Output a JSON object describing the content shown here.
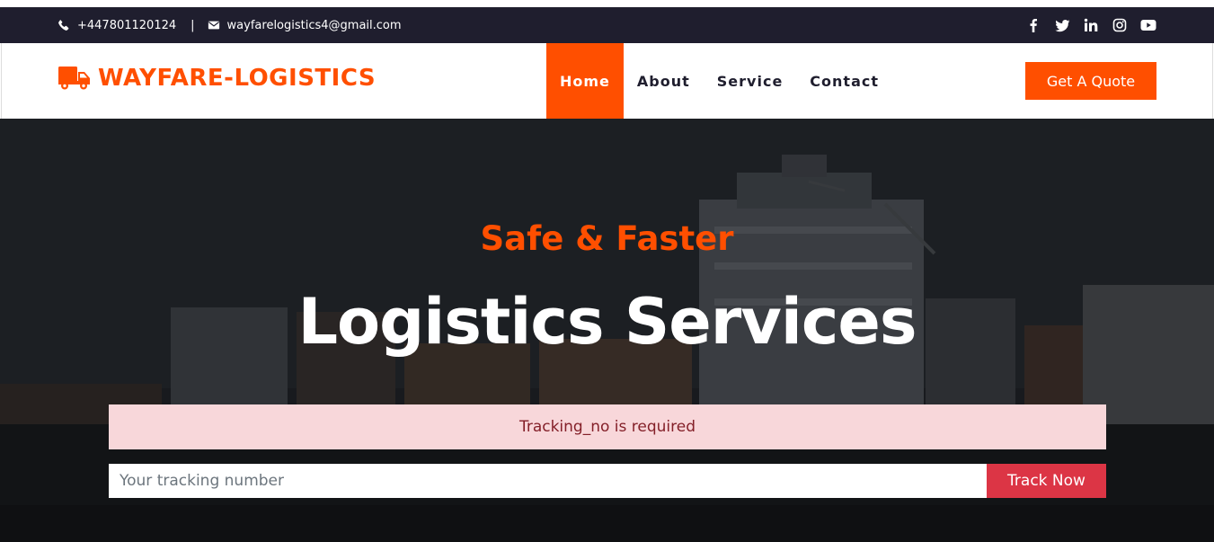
{
  "topbar": {
    "phone": "+447801120124",
    "separator": "|",
    "email": "wayfarelogistics4@gmail.com",
    "social_icons": [
      "facebook-icon",
      "twitter-icon",
      "linkedin-icon",
      "instagram-icon",
      "youtube-icon"
    ]
  },
  "brand": {
    "name": "WAYFARE-LOGISTICS",
    "icon": "truck-icon"
  },
  "nav": {
    "items": [
      {
        "label": "Home",
        "active": true
      },
      {
        "label": "About",
        "active": false
      },
      {
        "label": "Service",
        "active": false
      },
      {
        "label": "Contact",
        "active": false
      }
    ],
    "quote_label": "Get A Quote"
  },
  "hero": {
    "subtitle": "Safe & Faster",
    "title": "Logistics Services",
    "alert": "Tracking_no is required",
    "tracking_placeholder": "Your tracking number",
    "tracking_value": "",
    "track_button": "Track Now"
  },
  "colors": {
    "accent": "#ff4f00",
    "topbar_bg": "#1f1e2e",
    "alert_bg": "#f8d7da",
    "alert_text": "#842029",
    "track_button": "#dc3545"
  }
}
